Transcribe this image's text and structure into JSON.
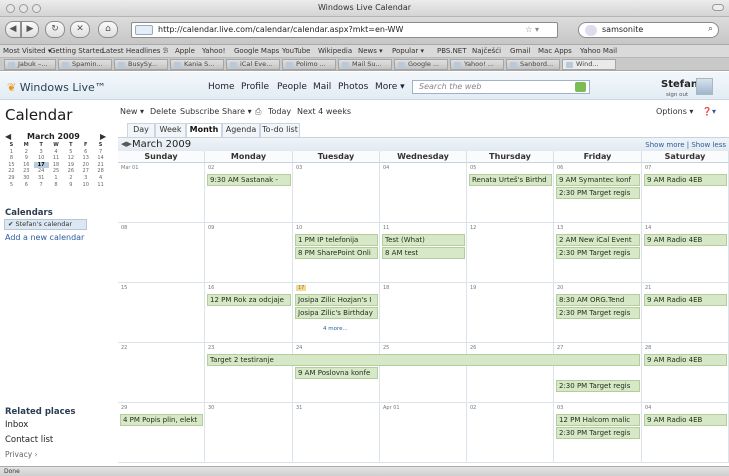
{
  "window": {
    "title": "Windows Live Calendar"
  },
  "browser": {
    "url": "http://calendar.live.com/calendar/calendar.aspx?mkt=en-WW",
    "search_value": "samsonite",
    "bookmarks": [
      "Most Visited ▾",
      "Getting Started",
      "Latest Headlines ℬ",
      "Apple",
      "Yahoo!",
      "Google Maps",
      "YouTube",
      "Wikipedia",
      "News ▾",
      "Popular ▾",
      "PBS.NET",
      "Najčešći",
      "Gmail",
      "Mac Apps",
      "Yahoo Mail"
    ],
    "tabs": [
      "Jabuk –...",
      "Spamin...",
      "BusySy...",
      "Kania S...",
      "iCal Eve...",
      "Polimo ...",
      "Mail Su...",
      "Google ...",
      "Yahoo! ...",
      "Sanbord...",
      "Wind..."
    ],
    "status": "Done"
  },
  "header": {
    "logo": "Windows Live™",
    "nav": [
      "Home",
      "Profile",
      "People",
      "Mail",
      "Photos",
      "More ▾"
    ],
    "search_placeholder": "Search the web",
    "user": "Stefan ▾",
    "signout": "sign out"
  },
  "sidebar": {
    "heading": "Calendar",
    "mini_month": "March 2009",
    "mini_days": [
      "S",
      "M",
      "T",
      "W",
      "T",
      "F",
      "S"
    ],
    "mini_weeks": [
      [
        "1",
        "2",
        "3",
        "4",
        "5",
        "6",
        "7"
      ],
      [
        "8",
        "9",
        "10",
        "11",
        "12",
        "13",
        "14"
      ],
      [
        "15",
        "16",
        "17",
        "18",
        "19",
        "20",
        "21"
      ],
      [
        "22",
        "23",
        "24",
        "25",
        "26",
        "27",
        "28"
      ],
      [
        "29",
        "30",
        "31",
        "1",
        "2",
        "3",
        "4"
      ],
      [
        "5",
        "6",
        "7",
        "8",
        "9",
        "10",
        "11"
      ]
    ],
    "calendars_label": "Calendars",
    "calendar_item": "✔ Stefan's calendar",
    "add_calendar": "Add a new calendar",
    "related_label": "Related places",
    "related": [
      "Inbox",
      "Contact list",
      "Privacy ›"
    ]
  },
  "commands": {
    "new": "New ▾",
    "delete": "Delete",
    "subscribe": "Subscribe",
    "share": "Share ▾",
    "today": "Today",
    "next": "Next 4 weeks",
    "options": "Options ▾"
  },
  "views": [
    "Day",
    "Week",
    "Month",
    "Agenda",
    "To-do list"
  ],
  "month_title": "March 2009",
  "show_more": "Show more  |  Show less",
  "weekdays": [
    "Sunday",
    "Monday",
    "Tuesday",
    "Wednesday",
    "Thursday",
    "Friday",
    "Saturday"
  ],
  "weeks": [
    {
      "days": [
        "Mar 01",
        "02",
        "03",
        "04",
        "05",
        "06",
        "07"
      ]
    },
    {
      "days": [
        "08",
        "09",
        "10",
        "11",
        "12",
        "13",
        "14"
      ]
    },
    {
      "days": [
        "15",
        "16",
        "17",
        "18",
        "19",
        "20",
        "21"
      ]
    },
    {
      "days": [
        "22",
        "23",
        "24",
        "25",
        "26",
        "27",
        "28"
      ]
    },
    {
      "days": [
        "29",
        "30",
        "31",
        "Apr 01",
        "02",
        "03",
        "04"
      ]
    }
  ],
  "events": {
    "w0_mon": "9:30 AM Sastanak - ",
    "w0_thu": "Renata Urteš's Birthd",
    "w0_fri1": "9 AM Symantec konf",
    "w0_fri2": "2:30 PM Target regis",
    "w0_sat": "9 AM Radio 4EB",
    "w1_tue1": "1 PM IP telefonija",
    "w1_tue2": "8 PM SharePoint Onli",
    "w1_wed1": "Test (What)",
    "w1_wed2": "8 AM test",
    "w1_fri1": "2 AM New iCal Event",
    "w1_fri2": "2:30 PM Target regis",
    "w1_sat": "9 AM Radio 4EB",
    "w2_mon": "12 PM Rok za odcjaje",
    "w2_tue1": "Josipa Zilic Hozjan's I",
    "w2_tue2": "Josipa Zilic's Birthday",
    "w2_more": "4 more...",
    "w2_fri1": "8:30 AM ORG.Tend",
    "w2_fri2": "2:30 PM Target regis",
    "w2_sat": "9 AM Radio 4EB",
    "w3_span": "Target 2 testiranje",
    "w3_tue": "9 AM Poslovna konfe",
    "w3_fri": "2:30 PM Target regis",
    "w3_sat": "9 AM Radio 4EB",
    "w4_sun": "4 PM Popis plin, elekt",
    "w4_fri1": "12 PM Halcom malic",
    "w4_fri2": "2:30 PM Target regis",
    "w4_sat": "9 AM Radio 4EB"
  },
  "colors": {
    "event_bg": "#d7e8c8",
    "event_border": "#b3cd9b",
    "today_bg": "#f6d98a",
    "link": "#2a5d9f"
  }
}
